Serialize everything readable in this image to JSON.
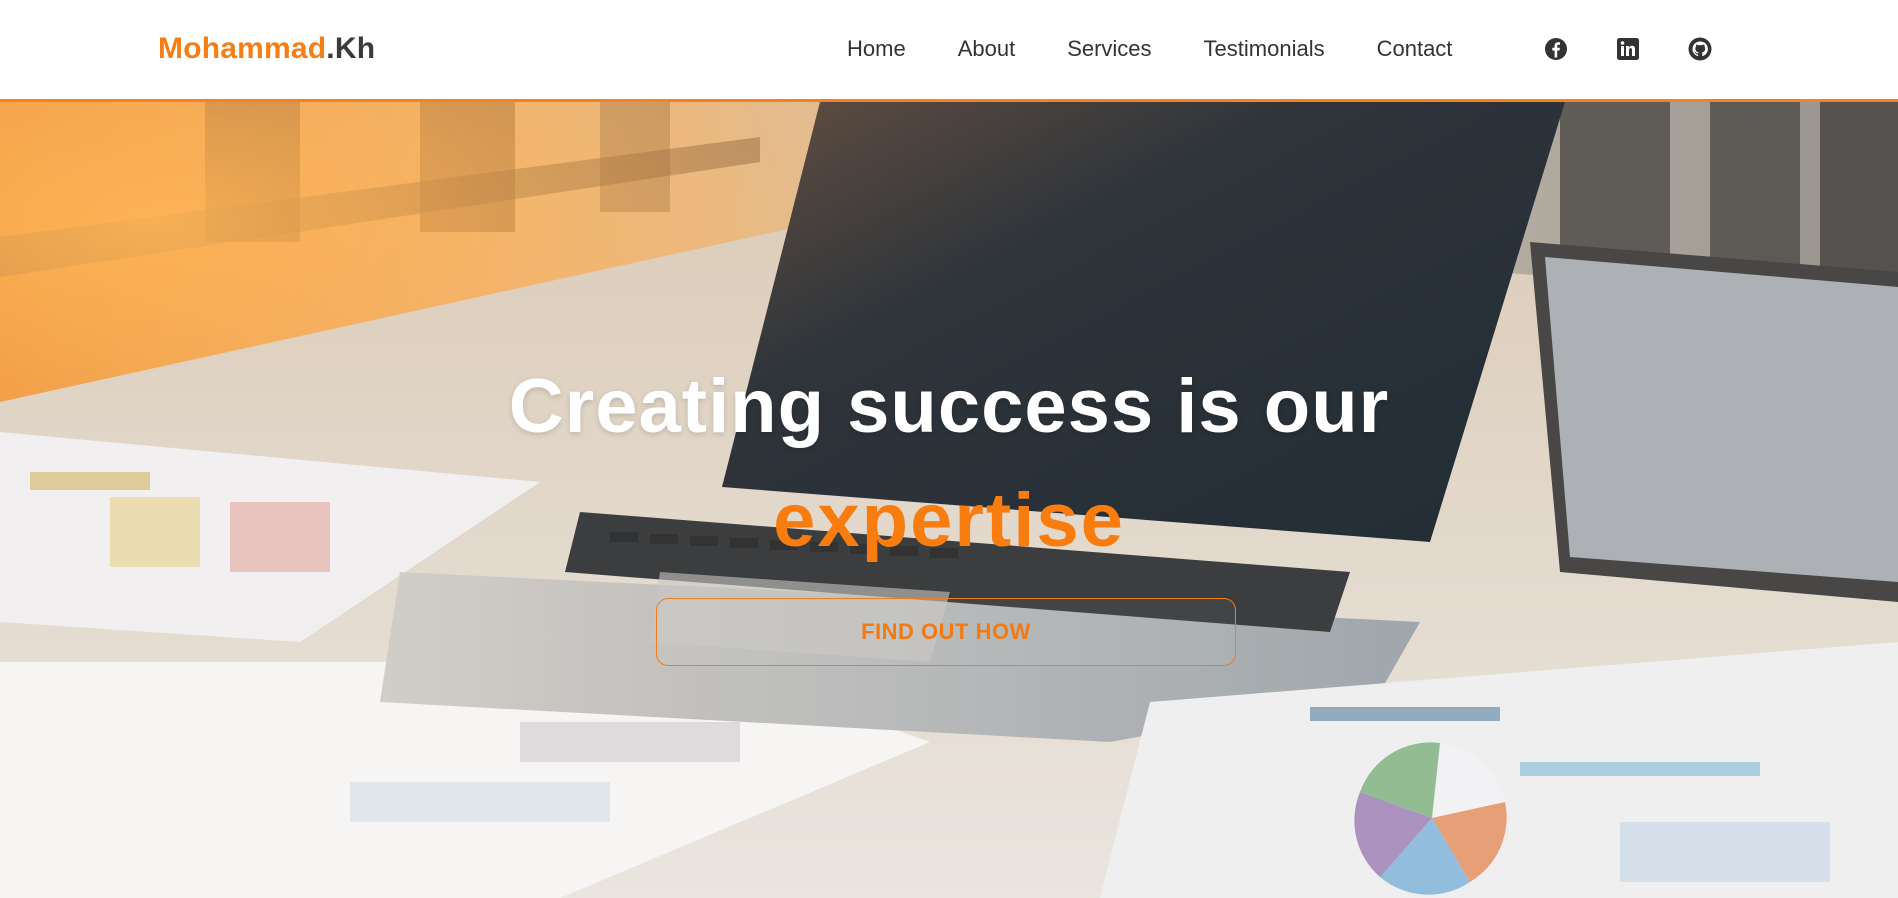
{
  "brand": {
    "first": "Mohammad",
    "second": ".Kh"
  },
  "nav": {
    "links": [
      {
        "label": "Home"
      },
      {
        "label": "About"
      },
      {
        "label": "Services"
      },
      {
        "label": "Testimonials"
      },
      {
        "label": "Contact"
      }
    ]
  },
  "social": [
    {
      "icon": "facebook-icon"
    },
    {
      "icon": "linkedin-icon"
    },
    {
      "icon": "github-icon"
    }
  ],
  "hero": {
    "title": "Creating success is our",
    "accent": "expertise",
    "cta_label": "FIND OUT HOW"
  },
  "colors": {
    "accent": "#f77d15",
    "nav_text": "#333333",
    "nav_border": "#f7811f"
  }
}
